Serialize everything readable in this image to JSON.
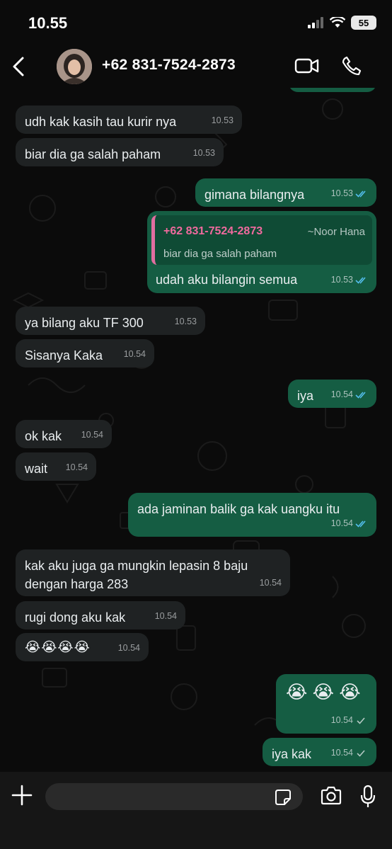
{
  "status_bar": {
    "time": "10.55",
    "battery": "55"
  },
  "header": {
    "contact_name": "+62 831-7524-2873"
  },
  "messages": [
    {
      "text": "udh kak kasih tau kurir nya",
      "time": "10.53"
    },
    {
      "text": "biar dia ga salah paham",
      "time": "10.53"
    },
    {
      "text": "gimana bilangnya",
      "time": "10.53",
      "status": "read"
    },
    {
      "quote_name": "+62 831-7524-2873",
      "quote_alias": "~Noor Hana",
      "quote_text": "biar dia ga salah paham",
      "text": "udah aku bilangin semua",
      "time": "10.53",
      "status": "read"
    },
    {
      "text": "ya bilang aku TF 300",
      "time": "10.53"
    },
    {
      "text": "Sisanya Kaka",
      "time": "10.54"
    },
    {
      "text": "iya",
      "time": "10.54",
      "status": "read"
    },
    {
      "text": "ok kak",
      "time": "10.54"
    },
    {
      "text": "wait",
      "time": "10.54"
    },
    {
      "text": "ada jaminan balik ga kak uangku itu",
      "time": "10.54",
      "status": "read"
    },
    {
      "text_line1": "kak aku juga ga mungkin lepasin 8 baju",
      "text_line2": "dengan harga 283",
      "time": "10.54"
    },
    {
      "text": "rugi dong aku kak",
      "time": "10.54"
    },
    {
      "text": "😭😭😭😭",
      "time": "10.54"
    },
    {
      "text": "😭 😭 😭",
      "time": "10.54",
      "status": "sent"
    },
    {
      "text": "iya kak",
      "time": "10.54",
      "status": "sent"
    }
  ],
  "colors": {
    "incoming": "#1f2223",
    "outgoing": "#155d43",
    "read_tick": "#53bdeb",
    "quote_accent": "#e26ea1"
  },
  "icons": [
    "back-arrow",
    "video-call",
    "phone",
    "plus",
    "sticker",
    "camera",
    "microphone"
  ]
}
